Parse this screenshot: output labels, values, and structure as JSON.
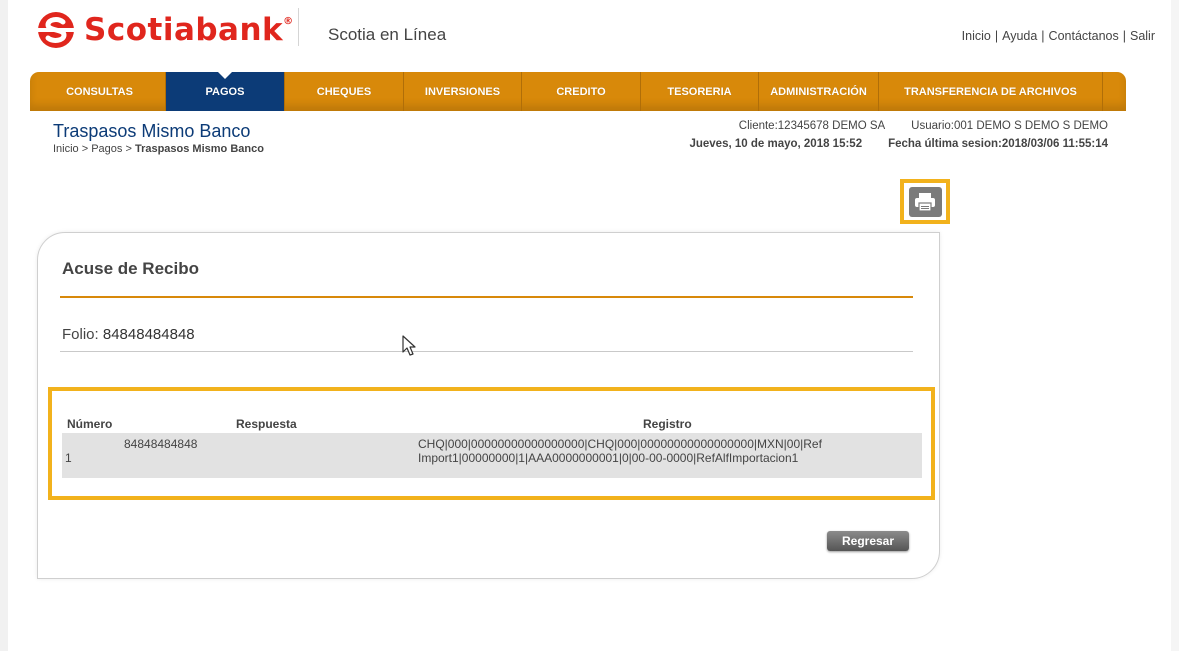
{
  "brand": {
    "name": "Scotiabank",
    "trademark": "®",
    "app_name": "Scotia en Línea",
    "accent": "#e0261d"
  },
  "top_links": [
    {
      "label": "Inicio"
    },
    {
      "label": "Ayuda"
    },
    {
      "label": "Contáctanos"
    },
    {
      "label": "Salir"
    }
  ],
  "nav": {
    "color": "#d8890a",
    "active_color": "#0c3b77",
    "items": [
      {
        "label": "CONSULTAS"
      },
      {
        "label": "PAGOS",
        "active": true
      },
      {
        "label": "CHEQUES"
      },
      {
        "label": "INVERSIONES"
      },
      {
        "label": "CREDITO"
      },
      {
        "label": "TESORERIA"
      },
      {
        "label": "ADMINISTRACIÓN"
      },
      {
        "label": "TRANSFERENCIA DE ARCHIVOS"
      }
    ]
  },
  "page": {
    "title": "Traspasos Mismo Banco",
    "breadcrumb": {
      "path": "Inicio > Pagos > ",
      "current": "Traspasos Mismo Banco"
    }
  },
  "session": {
    "cliente": "Cliente:12345678  DEMO SA",
    "usuario": "Usuario:001 DEMO S DEMO S DEMO",
    "fecha": "Jueves, 10 de mayo, 2018 15:52",
    "ultima_sesion": "Fecha última sesion:2018/03/06 11:55:14"
  },
  "print_icon": "printer-icon",
  "receipt": {
    "title": "Acuse de Recibo",
    "folio_label": "Folio: ",
    "folio_value": "84848484848",
    "table": {
      "headers": {
        "numero": "Número",
        "respuesta": "Respuesta",
        "registro": "Registro"
      },
      "rows": [
        {
          "index": "1",
          "numero": "84848484848",
          "respuesta": "",
          "registro_line1": "CHQ|000|00000000000000000|CHQ|000|00000000000000000|MXN|00|Ref",
          "registro_line2": "Import1|00000000|1|AAA0000000001|0|00-00-0000|RefAlfImportacion1"
        }
      ]
    },
    "back_button": "Regresar"
  },
  "highlight_color": "#f2b21c"
}
